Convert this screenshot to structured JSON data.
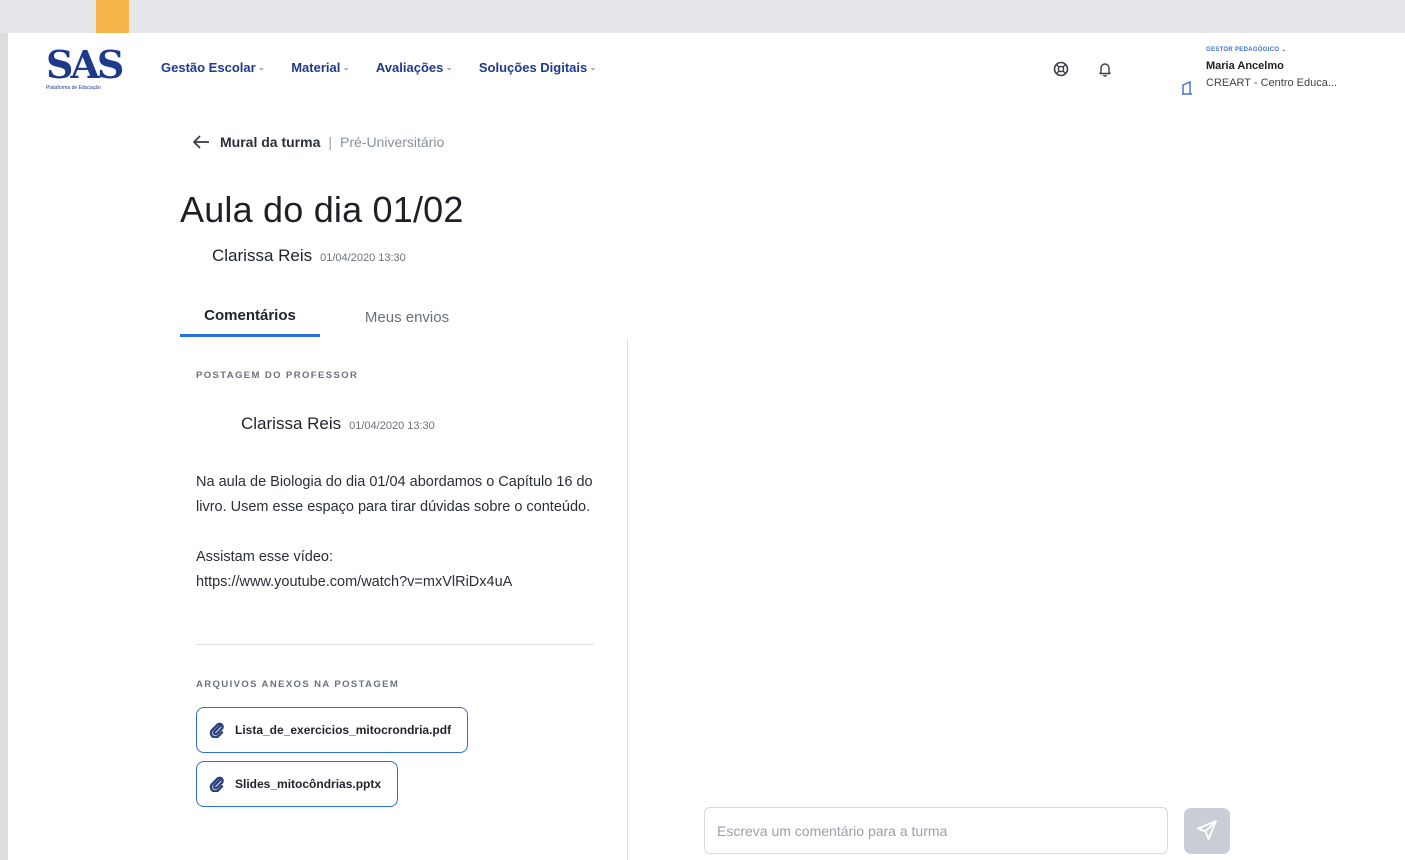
{
  "app": {
    "logo_text": "SAS",
    "logo_tagline": "Plataforma de Educação"
  },
  "nav": {
    "items": [
      {
        "label": "Gestão Escolar"
      },
      {
        "label": "Material"
      },
      {
        "label": "Avaliações"
      },
      {
        "label": "Soluções Digitais"
      }
    ],
    "chevron": "⌄"
  },
  "header_icons": {
    "help": "help-icon",
    "notifications": "bell-icon"
  },
  "user": {
    "role": "GESTOR PEDAGÓGICO ⌄",
    "name": "Maria Ancelmo",
    "school": "CREART - Centro Educa..."
  },
  "breadcrumb": {
    "parent": "Mural da turma",
    "separator": "|",
    "current": "Pré-Universitário"
  },
  "post": {
    "title": "Aula do dia 01/02",
    "author": "Clarissa Reis",
    "date": "01/04/2020 13:30"
  },
  "tabs": [
    {
      "label": "Comentários",
      "active": true
    },
    {
      "label": "Meus envios",
      "active": false
    }
  ],
  "teacher_post": {
    "section_label": "POSTAGEM DO PROFESSOR",
    "author": "Clarissa Reis",
    "date": "01/04/2020 13:30",
    "body_paragraph": "Na aula de Biologia do dia 01/04 abordamos o Capítulo 16 do livro. Usem esse espaço para tirar dúvidas sobre o conteúdo.",
    "video_intro": "Assistam esse vídeo:",
    "video_link": "https://www.youtube.com/watch?v=mxVlRiDx4uA"
  },
  "attachments": {
    "section_label": "ARQUIVOS ANEXOS NA POSTAGEM",
    "files": [
      {
        "name": "Lista_de_exercicios_mitocrondria.pdf"
      },
      {
        "name": "Slides_mitocôndrias.pptx"
      }
    ]
  },
  "comment_box": {
    "placeholder": "Escreva um comentário para a turma",
    "value": ""
  },
  "colors": {
    "accent": "#2a6fdb",
    "brand": "#1d3a8a",
    "orange_tab": "#f3b44a",
    "send_disabled": "#c9ced6"
  }
}
